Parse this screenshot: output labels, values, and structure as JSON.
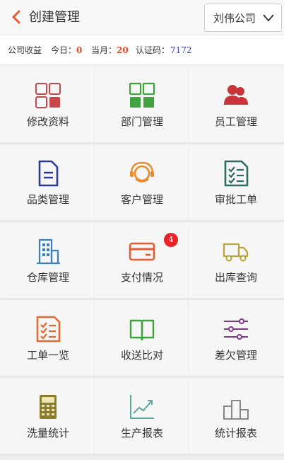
{
  "header": {
    "title": "创建管理",
    "company": "刘伟公司"
  },
  "info": {
    "label": "公司收益",
    "today_label": "今日：",
    "today_value": "0",
    "month_label": "当月：",
    "month_value": "20",
    "code_label": "认证码：",
    "code_value": "7172"
  },
  "menu": [
    {
      "label": "修改资料",
      "icon": "grid-squares-icon"
    },
    {
      "label": "部门管理",
      "icon": "department-grid-icon"
    },
    {
      "label": "员工管理",
      "icon": "users-icon"
    },
    {
      "label": "品类管理",
      "icon": "document-icon"
    },
    {
      "label": "客户管理",
      "icon": "headset-icon"
    },
    {
      "label": "审批工单",
      "icon": "checklist-icon"
    },
    {
      "label": "仓库管理",
      "icon": "building-icon"
    },
    {
      "label": "支付情况",
      "icon": "card-icon",
      "badge": "4"
    },
    {
      "label": "出库查询",
      "icon": "truck-icon"
    },
    {
      "label": "工单一览",
      "icon": "task-list-icon"
    },
    {
      "label": "收送比对",
      "icon": "book-icon"
    },
    {
      "label": "差欠管理",
      "icon": "sliders-icon"
    },
    {
      "label": "洗量统计",
      "icon": "calculator-icon"
    },
    {
      "label": "生产报表",
      "icon": "trend-chart-icon"
    },
    {
      "label": "统计报表",
      "icon": "podium-icon"
    }
  ],
  "colors": {
    "accent": "#e85a30",
    "red": "#c8474a",
    "green": "#3fa33f",
    "navy": "#2b3b8f",
    "orange": "#e98b2a",
    "teal": "#2e6b61",
    "blue": "#3a7fc0",
    "olive": "#b8a43a",
    "purple": "#7b3a85",
    "gray": "#888888"
  }
}
